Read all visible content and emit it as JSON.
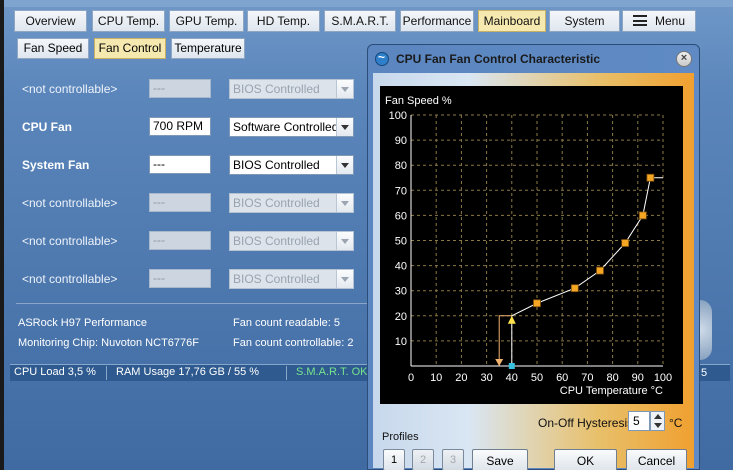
{
  "main_tabs": [
    {
      "label": "Overview"
    },
    {
      "label": "CPU Temp."
    },
    {
      "label": "GPU Temp."
    },
    {
      "label": "HD Temp."
    },
    {
      "label": "S.M.A.R.T."
    },
    {
      "label": "Performance"
    },
    {
      "label": "Mainboard",
      "active": true
    },
    {
      "label": "System"
    },
    {
      "label": "Menu",
      "icon": "hamburger-menu-icon"
    }
  ],
  "sub_tabs": [
    {
      "label": "Fan Speed"
    },
    {
      "label": "Fan Control",
      "active": true
    },
    {
      "label": "Temperature"
    }
  ],
  "fans": [
    {
      "label": "<not controllable>",
      "rpm": "---",
      "mode": "BIOS Controlled",
      "enabled": false
    },
    {
      "label": "CPU Fan",
      "rpm": "700 RPM",
      "mode": "Software Controlled",
      "enabled": true
    },
    {
      "label": "System Fan",
      "rpm": "---",
      "mode": "BIOS Controlled",
      "enabled": true
    },
    {
      "label": "<not controllable>",
      "rpm": "---",
      "mode": "BIOS Controlled",
      "enabled": false
    },
    {
      "label": "<not controllable>",
      "rpm": "---",
      "mode": "BIOS Controlled",
      "enabled": false
    },
    {
      "label": "<not controllable>",
      "rpm": "---",
      "mode": "BIOS Controlled",
      "enabled": false
    }
  ],
  "info": {
    "board": "ASRock H97 Performance",
    "chip": "Monitoring Chip: Nuvoton NCT6776F",
    "fan_readable": "Fan count readable: 5",
    "fan_controllable": "Fan count controllable: 2"
  },
  "status": {
    "cpu_load": "CPU Load 3,5 %",
    "ram": "RAM Usage 17,76 GB / 55 %",
    "smart": "S.M.A.R.T. OK",
    "edge_number": "5"
  },
  "dialog": {
    "title": "CPU Fan Fan Control Characteristic",
    "close_symbol": "×",
    "hysteresis_label": "On-Off Hysteresis",
    "hysteresis_value": "5",
    "hysteresis_unit": "°C",
    "profiles_label": "Profiles",
    "profile_buttons": [
      "1",
      "2",
      "3"
    ],
    "save_label": "Save",
    "ok_label": "OK",
    "cancel_label": "Cancel"
  },
  "colors": {
    "curve": "#ffffff",
    "point": "#f5a623",
    "hysteresis": "#f2b36c",
    "start_point": "#39c0e0",
    "grid": "#8c7a46"
  },
  "chart_data": {
    "type": "line",
    "title": "",
    "xlabel": "CPU Temperature °C",
    "ylabel": "Fan Speed %",
    "xlim": [
      0,
      100
    ],
    "ylim": [
      0,
      100
    ],
    "x_ticks": [
      "0",
      "10",
      "20",
      "30",
      "40",
      "50",
      "60",
      "70",
      "80",
      "90",
      "100"
    ],
    "y_ticks": [
      "10",
      "20",
      "30",
      "40",
      "50",
      "60",
      "70",
      "80",
      "90",
      "100"
    ],
    "grid": true,
    "series": [
      {
        "x": [
          40,
          40,
          50,
          65,
          75,
          85,
          92,
          95,
          100
        ],
        "y": [
          0,
          20,
          25,
          31,
          38,
          49,
          60,
          75,
          75
        ]
      }
    ],
    "hysteresis_line": {
      "x": [
        35,
        35,
        40
      ],
      "y": [
        0,
        20,
        20
      ]
    }
  }
}
